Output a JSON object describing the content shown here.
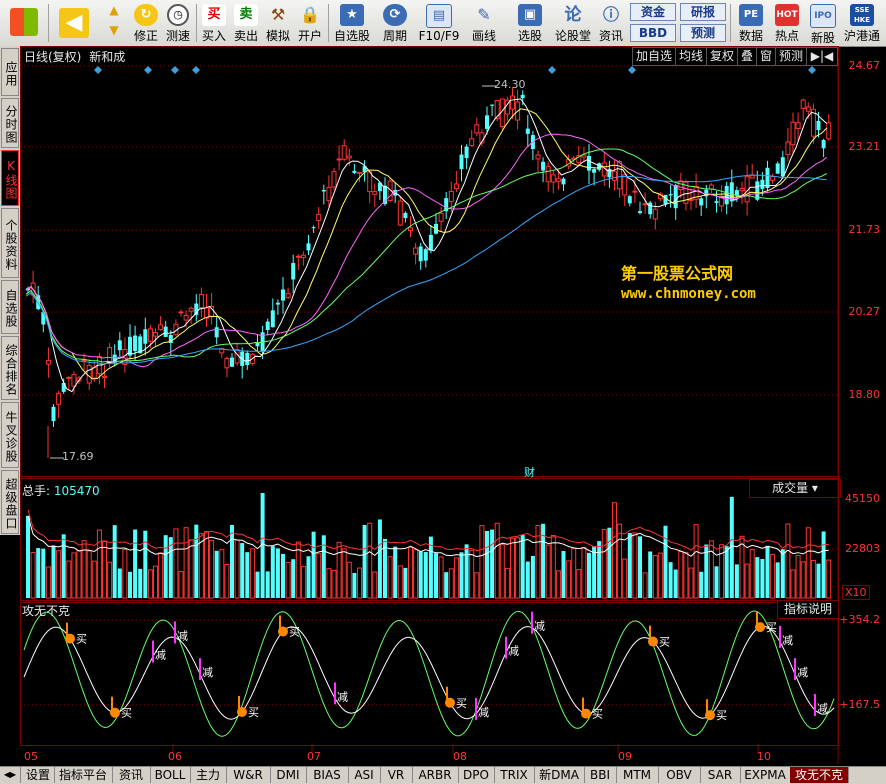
{
  "toolbar": {
    "buttons": [
      {
        "label": "修正"
      },
      {
        "label": "测速"
      },
      {
        "label": "买入"
      },
      {
        "label": "卖出"
      },
      {
        "label": "模拟"
      },
      {
        "label": "开户"
      },
      {
        "label": "自选股"
      },
      {
        "label": "周期"
      },
      {
        "label": "F10/F9"
      },
      {
        "label": "画线"
      },
      {
        "label": "选股"
      },
      {
        "label": "论股堂"
      },
      {
        "label": "资讯"
      },
      {
        "label": "数据"
      },
      {
        "label": "热点"
      },
      {
        "label": "新股"
      },
      {
        "label": "沪港通"
      }
    ],
    "buy_glyph": "买",
    "sell_glyph": "卖",
    "lun_glyph": "论",
    "mini": {
      "zijin": "资金",
      "yanbao": "研报",
      "bbd": "BBD",
      "yuce": "预测"
    },
    "pe_glyph": "PE",
    "hot_glyph": "HOT",
    "ipo_glyph": "IPO",
    "hk_glyph": "SSE HKE"
  },
  "sidebar": [
    {
      "label": "应用"
    },
    {
      "label": "分时图"
    },
    {
      "label": "K线图",
      "active": true
    },
    {
      "label": "个股资料"
    },
    {
      "label": "自选股"
    },
    {
      "label": "综合排名"
    },
    {
      "label": "牛叉诊股"
    },
    {
      "label": "超级盘口"
    }
  ],
  "header": {
    "period": "日线(复权)",
    "stock": "新和成",
    "buttons": [
      "加自选",
      "均线",
      "复权",
      "叠",
      "窗",
      "预测"
    ],
    "arrows": "▶|◀"
  },
  "price_axis": [
    "24.67",
    "23.21",
    "21.73",
    "20.27",
    "18.80"
  ],
  "annotations": {
    "high": "24.30",
    "low": "17.69",
    "cai": "财",
    "watermark1": "第一股票公式网",
    "watermark2": "www.chnmoney.com"
  },
  "volume": {
    "label": "总手:",
    "value": "105470",
    "selector": "成交量",
    "axis": [
      "45150",
      "22803"
    ],
    "unit": "X10"
  },
  "indicator": {
    "name": "攻无不克",
    "help": "指标说明",
    "axis": [
      "354.2",
      "167.5"
    ],
    "buy": "买",
    "sell": "减"
  },
  "months": [
    "05",
    "06",
    "07",
    "08",
    "09",
    "10"
  ],
  "bottom_tabs": [
    "设置",
    "指标平台",
    "资讯",
    "BOLL",
    "主力",
    "W&R",
    "DMI",
    "BIAS",
    "ASI",
    "VR",
    "ARBR",
    "DPO",
    "TRIX",
    "新DMA",
    "BBI",
    "MTM",
    "OBV",
    "SAR",
    "EXPMA",
    "攻无不克"
  ],
  "colors": {
    "up": "#ff3232",
    "down": "#54ffff",
    "grid": "#800000",
    "accent": "#ffcc00"
  }
}
